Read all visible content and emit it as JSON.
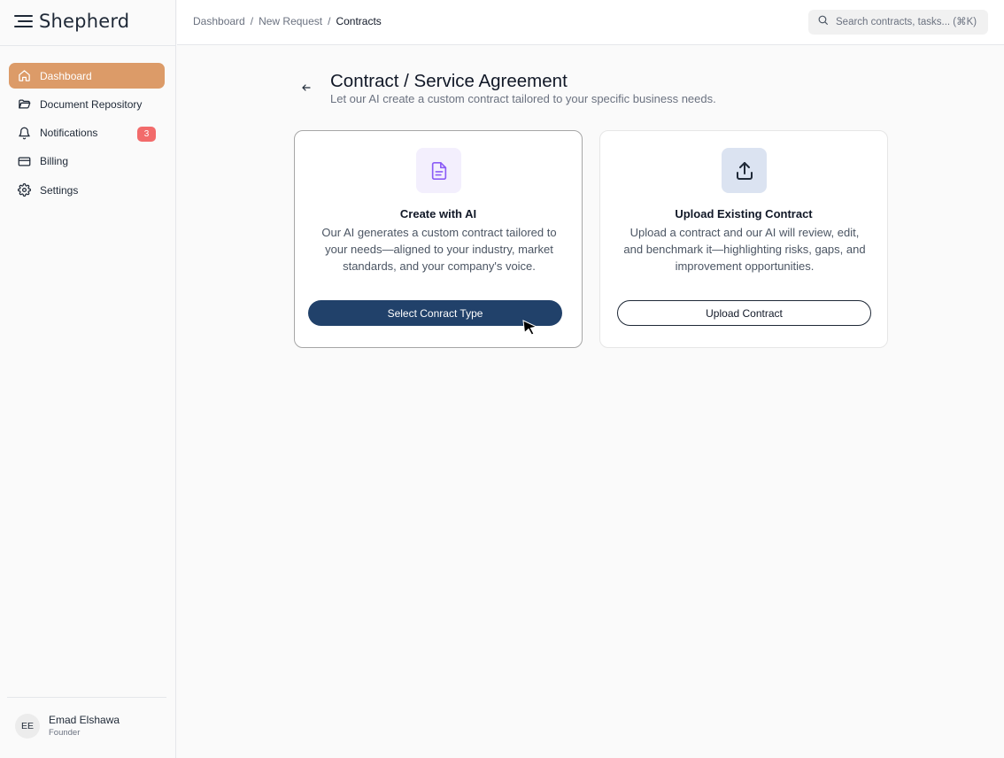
{
  "app": {
    "name": "Shepherd"
  },
  "sidebar": {
    "items": [
      {
        "label": "Dashboard",
        "icon": "home-icon",
        "active": true
      },
      {
        "label": "Document Repository",
        "icon": "folder-icon"
      },
      {
        "label": "Notifications",
        "icon": "bell-icon",
        "badge": "3"
      },
      {
        "label": "Billing",
        "icon": "credit-card-icon"
      },
      {
        "label": "Settings",
        "icon": "gear-icon"
      }
    ],
    "user": {
      "initials": "EE",
      "name": "Emad Elshawa",
      "role": "Founder"
    }
  },
  "header": {
    "breadcrumb": [
      "Dashboard",
      "New Request",
      "Contracts"
    ],
    "separator": "/",
    "search": {
      "placeholder": "Search contracts, tasks... (⌘K)"
    }
  },
  "main": {
    "title": "Contract / Service Agreement",
    "subtitle": "Let our AI create a custom contract tailored to your specific business needs.",
    "cards": [
      {
        "icon": "document-icon",
        "title": "Create with AI",
        "description": "Our AI generates a custom contract tailored to your needs—aligned to your industry, market standards, and your company's voice.",
        "button": "Select Conract Type"
      },
      {
        "icon": "upload-icon",
        "title": "Upload Existing Contract",
        "description": "Upload a contract and our AI will review, edit, and benchmark it—highlighting risks, gaps, and improvement opportunities.",
        "button": "Upload Contract"
      }
    ]
  },
  "colors": {
    "accent": "#dc9b68",
    "primary_button": "#21416a",
    "badge": "#f26b6b"
  }
}
